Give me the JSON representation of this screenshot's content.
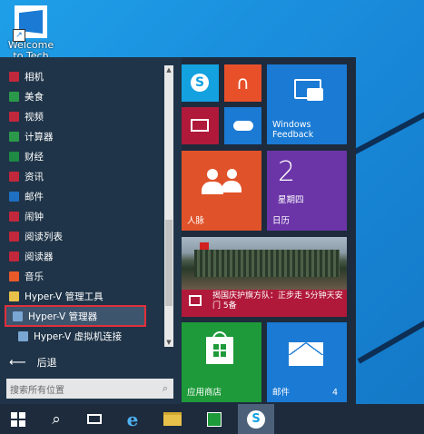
{
  "desktop": {
    "icon": {
      "label": "Welcome to Tech Previ...",
      "icon": "windows-setup-icon"
    }
  },
  "start_menu": {
    "apps": [
      {
        "label": "相机",
        "icon": "camera-icon",
        "color": "#c2283c"
      },
      {
        "label": "美食",
        "icon": "food-icon",
        "color": "#2a9a4a"
      },
      {
        "label": "视频",
        "icon": "video-icon",
        "color": "#c2283c"
      },
      {
        "label": "计算器",
        "icon": "calculator-icon",
        "color": "#2a9a4a"
      },
      {
        "label": "财经",
        "icon": "finance-icon",
        "color": "#1e8a44"
      },
      {
        "label": "资讯",
        "icon": "news-icon",
        "color": "#c2283c"
      },
      {
        "label": "邮件",
        "icon": "mail-icon",
        "color": "#1f6fc2"
      },
      {
        "label": "闹钟",
        "icon": "alarm-icon",
        "color": "#c2283c"
      },
      {
        "label": "阅读列表",
        "icon": "reading-list-icon",
        "color": "#c2283c"
      },
      {
        "label": "阅读器",
        "icon": "reader-icon",
        "color": "#c2283c"
      },
      {
        "label": "音乐",
        "icon": "music-icon",
        "color": "#e8592a"
      },
      {
        "label": "Hyper-V 管理工具",
        "icon": "folder-icon",
        "color": "#e8c14a"
      },
      {
        "label": "Hyper-V 管理器",
        "icon": "hyperv-manager-icon",
        "color": "#7aa6d4"
      },
      {
        "label": "Hyper-V 虚拟机连接",
        "icon": "hyperv-vm-connect-icon",
        "color": "#7aa6d4"
      }
    ],
    "back_label": "后退",
    "search_placeholder": "搜索所有位置",
    "tiles": {
      "skype": {
        "icon": "skype-icon",
        "color": "#14a1e0"
      },
      "music": {
        "icon": "headphones-icon",
        "color": "#e8502a"
      },
      "feedback": {
        "label": "Windows Feedback",
        "icon": "feedback-icon",
        "color": "#1a7ad4"
      },
      "video": {
        "icon": "video-icon",
        "color": "#b0193a"
      },
      "onedrive": {
        "icon": "onedrive-icon",
        "color": "#1a7ad4"
      },
      "people": {
        "label": "人脉",
        "icon": "people-icon",
        "color": "#e0522a"
      },
      "calendar": {
        "day": "2",
        "weekday": "星期四",
        "label": "日历",
        "color": "#6b35a8"
      },
      "news": {
        "headline": "揭国庆护旗方队：正步走 5分钟天安门 5备",
        "count": "5",
        "color": "#b0193a"
      },
      "store": {
        "label": "应用商店",
        "icon": "store-icon",
        "color": "#1e9a3a"
      },
      "mail": {
        "label": "邮件",
        "count": "4",
        "icon": "mail-icon",
        "color": "#1a7ad4"
      }
    }
  },
  "taskbar": {
    "items": [
      {
        "icon": "start-windows-icon"
      },
      {
        "icon": "search-icon"
      },
      {
        "icon": "task-view-icon"
      },
      {
        "icon": "internet-explorer-icon"
      },
      {
        "icon": "file-explorer-icon"
      },
      {
        "icon": "store-icon"
      },
      {
        "icon": "skype-icon"
      }
    ]
  }
}
